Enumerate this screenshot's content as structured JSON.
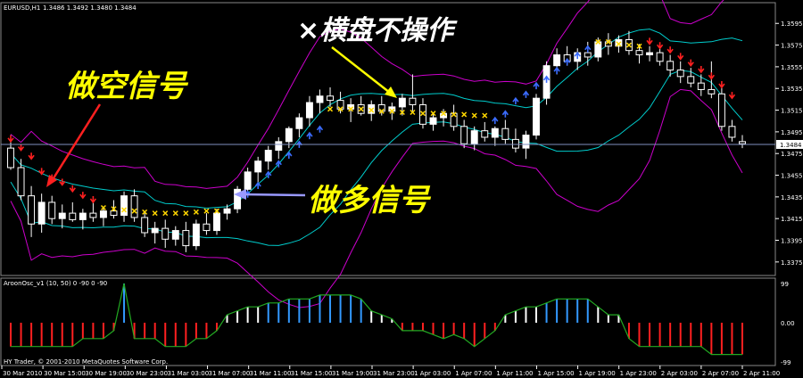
{
  "window": {
    "symbol_title": "EURUSD,H1",
    "ohlc": "1.3486 1.3492 1.3480 1.3484",
    "indicator_title": "AroonOsc_v1 (10, 50) 0 -90 0 -90",
    "copyright": "HY Trader, © 2001-2010 MetaQuotes Software Corp."
  },
  "annotations": {
    "sell_signal": "做空信号",
    "buy_signal": "做多信号",
    "range_note": "×横盘不操作"
  },
  "price_axis": {
    "current_price": "1.3484",
    "ticks": [
      "1.3595",
      "1.3575",
      "1.3555",
      "1.3535",
      "1.3515",
      "1.3495",
      "1.3475",
      "1.3455",
      "1.3435",
      "1.3415",
      "1.3395",
      "1.3375"
    ]
  },
  "osc_axis": {
    "ticks": [
      "99",
      "0.00",
      "-99"
    ]
  },
  "time_axis": {
    "labels": [
      "30 Mar 2010",
      "30 Mar 15:00",
      "30 Mar 19:00",
      "30 Mar 23:00",
      "31 Mar 03:00",
      "31 Mar 07:00",
      "31 Mar 11:00",
      "31 Mar 15:00",
      "31 Mar 19:00",
      "31 Mar 23:00",
      "1 Apr 03:00",
      "1 Apr 07:00",
      "1 Apr 11:00",
      "1 Apr 15:00",
      "1 Apr 19:00",
      "1 Apr 23:00",
      "2 Apr 03:00",
      "2 Apr 07:00",
      "2 Apr 11:00"
    ]
  },
  "colors": {
    "bg": "#000000",
    "band_outer": "#cc00cc",
    "band_inner": "#00cccc",
    "up_candle": "#ffffff",
    "down_candle": "#000000",
    "buy_arrow": "#3b6cff",
    "sell_arrow": "#ff2020",
    "range_x": "#ffd700",
    "annotation_text": "#ffff00",
    "osc_pos": "#3399ff",
    "osc_white": "#ffffff",
    "osc_neg": "#ff2020",
    "osc_line": "#22aa22",
    "grid": "#7f8fbf"
  },
  "chart_data": {
    "type": "candlestick",
    "symbol": "EURUSD",
    "timeframe": "H1",
    "price_range": [
      1.3365,
      1.361
    ],
    "candles": [
      [
        1.348,
        1.3492,
        1.346,
        1.3462
      ],
      [
        1.3462,
        1.347,
        1.3432,
        1.3436
      ],
      [
        1.3436,
        1.3445,
        1.3398,
        1.341
      ],
      [
        1.341,
        1.3438,
        1.3402,
        1.343
      ],
      [
        1.343,
        1.3436,
        1.341,
        1.3415
      ],
      [
        1.3415,
        1.3428,
        1.3406,
        1.342
      ],
      [
        1.342,
        1.343,
        1.3412,
        1.3414
      ],
      [
        1.3414,
        1.3424,
        1.3405,
        1.342
      ],
      [
        1.342,
        1.343,
        1.3412,
        1.3416
      ],
      [
        1.3416,
        1.3426,
        1.3408,
        1.3422
      ],
      [
        1.3422,
        1.3432,
        1.3415,
        1.3418
      ],
      [
        1.3418,
        1.344,
        1.3412,
        1.3436
      ],
      [
        1.3436,
        1.3442,
        1.3412,
        1.3416
      ],
      [
        1.3416,
        1.3422,
        1.3398,
        1.3402
      ],
      [
        1.3402,
        1.3412,
        1.3392,
        1.3406
      ],
      [
        1.3406,
        1.3414,
        1.3388,
        1.3396
      ],
      [
        1.3396,
        1.3408,
        1.339,
        1.3404
      ],
      [
        1.3404,
        1.3412,
        1.3384,
        1.339
      ],
      [
        1.339,
        1.3414,
        1.3386,
        1.341
      ],
      [
        1.341,
        1.342,
        1.34,
        1.3404
      ],
      [
        1.3404,
        1.3424,
        1.34,
        1.342
      ],
      [
        1.342,
        1.3428,
        1.3414,
        1.3424
      ],
      [
        1.3424,
        1.3445,
        1.342,
        1.3442
      ],
      [
        1.3442,
        1.3462,
        1.3436,
        1.3458
      ],
      [
        1.3458,
        1.3472,
        1.3448,
        1.3468
      ],
      [
        1.3468,
        1.3482,
        1.346,
        1.3478
      ],
      [
        1.3478,
        1.349,
        1.347,
        1.3486
      ],
      [
        1.3486,
        1.35,
        1.348,
        1.3498
      ],
      [
        1.3498,
        1.3512,
        1.349,
        1.3508
      ],
      [
        1.3508,
        1.3528,
        1.35,
        1.3522
      ],
      [
        1.3522,
        1.3534,
        1.3512,
        1.3528
      ],
      [
        1.3528,
        1.3536,
        1.3518,
        1.3524
      ],
      [
        1.3524,
        1.3532,
        1.3512,
        1.3516
      ],
      [
        1.3516,
        1.3526,
        1.3504,
        1.352
      ],
      [
        1.352,
        1.3528,
        1.351,
        1.3512
      ],
      [
        1.3512,
        1.3524,
        1.3505,
        1.352
      ],
      [
        1.352,
        1.3528,
        1.351,
        1.3514
      ],
      [
        1.3514,
        1.3522,
        1.3506,
        1.3518
      ],
      [
        1.3518,
        1.353,
        1.351,
        1.3526
      ],
      [
        1.3526,
        1.3548,
        1.3514,
        1.352
      ],
      [
        1.352,
        1.3526,
        1.3498,
        1.3502
      ],
      [
        1.3502,
        1.3512,
        1.3496,
        1.3508
      ],
      [
        1.3508,
        1.3516,
        1.35,
        1.3512
      ],
      [
        1.3512,
        1.352,
        1.3496,
        1.35
      ],
      [
        1.35,
        1.3506,
        1.348,
        1.3484
      ],
      [
        1.3484,
        1.35,
        1.3478,
        1.3496
      ],
      [
        1.3496,
        1.3504,
        1.3486,
        1.349
      ],
      [
        1.349,
        1.35,
        1.3482,
        1.3498
      ],
      [
        1.3498,
        1.3506,
        1.3484,
        1.3488
      ],
      [
        1.3488,
        1.3498,
        1.3476,
        1.348
      ],
      [
        1.348,
        1.3496,
        1.347,
        1.3492
      ],
      [
        1.3492,
        1.353,
        1.3488,
        1.3526
      ],
      [
        1.3526,
        1.356,
        1.352,
        1.3556
      ],
      [
        1.3556,
        1.3572,
        1.3548,
        1.3566
      ],
      [
        1.3566,
        1.3574,
        1.3556,
        1.356
      ],
      [
        1.356,
        1.3572,
        1.3552,
        1.3568
      ],
      [
        1.3568,
        1.3578,
        1.3556,
        1.3564
      ],
      [
        1.3564,
        1.3582,
        1.356,
        1.3578
      ],
      [
        1.3578,
        1.3586,
        1.3566,
        1.3574
      ],
      [
        1.3574,
        1.3584,
        1.3568,
        1.358
      ],
      [
        1.358,
        1.3588,
        1.3566,
        1.357
      ],
      [
        1.357,
        1.3576,
        1.3558,
        1.3566
      ],
      [
        1.3566,
        1.3574,
        1.356,
        1.3568
      ],
      [
        1.3568,
        1.3574,
        1.3556,
        1.356
      ],
      [
        1.356,
        1.3566,
        1.3546,
        1.3552
      ],
      [
        1.3552,
        1.356,
        1.354,
        1.3546
      ],
      [
        1.3546,
        1.3554,
        1.3536,
        1.354
      ],
      [
        1.354,
        1.3548,
        1.3528,
        1.3534
      ],
      [
        1.3534,
        1.356,
        1.3526,
        1.353
      ],
      [
        1.353,
        1.3536,
        1.3496,
        1.35
      ],
      [
        1.35,
        1.3506,
        1.3486,
        1.349
      ],
      [
        1.3486,
        1.3492,
        1.348,
        1.3484
      ]
    ],
    "signals": {
      "sell_arrows": [
        [
          0,
          1.3486
        ],
        [
          1,
          1.3478
        ],
        [
          2,
          1.347
        ],
        [
          3,
          1.3456
        ],
        [
          4,
          1.345
        ],
        [
          5,
          1.3446
        ],
        [
          6,
          1.344
        ],
        [
          7,
          1.3434
        ],
        [
          8,
          1.343
        ],
        [
          62,
          1.3576
        ],
        [
          63,
          1.3572
        ],
        [
          64,
          1.3568
        ],
        [
          65,
          1.3562
        ],
        [
          66,
          1.3556
        ],
        [
          67,
          1.355
        ],
        [
          68,
          1.3544
        ],
        [
          69,
          1.3536
        ],
        [
          70,
          1.3526
        ]
      ],
      "buy_arrows": [
        [
          23,
          1.344
        ],
        [
          24,
          1.3448
        ],
        [
          25,
          1.3458
        ],
        [
          26,
          1.3468
        ],
        [
          27,
          1.3476
        ],
        [
          28,
          1.3486
        ],
        [
          29,
          1.3494
        ],
        [
          30,
          1.35
        ],
        [
          47,
          1.3508
        ],
        [
          48,
          1.3514
        ],
        [
          49,
          1.3526
        ],
        [
          50,
          1.3532
        ],
        [
          51,
          1.354
        ],
        [
          52,
          1.3546
        ],
        [
          53,
          1.3554
        ],
        [
          54,
          1.3562
        ],
        [
          55,
          1.3568
        ],
        [
          56,
          1.3574
        ]
      ],
      "range_x": [
        [
          9,
          1.3425
        ],
        [
          10,
          1.3424
        ],
        [
          11,
          1.3423
        ],
        [
          12,
          1.3422
        ],
        [
          13,
          1.3421
        ],
        [
          14,
          1.342
        ],
        [
          15,
          1.342
        ],
        [
          16,
          1.342
        ],
        [
          17,
          1.342
        ],
        [
          18,
          1.3421
        ],
        [
          19,
          1.3422
        ],
        [
          20,
          1.3422
        ],
        [
          31,
          1.3516
        ],
        [
          32,
          1.3516
        ],
        [
          33,
          1.3516
        ],
        [
          34,
          1.3516
        ],
        [
          35,
          1.3515
        ],
        [
          36,
          1.3514
        ],
        [
          37,
          1.3514
        ],
        [
          38,
          1.3513
        ],
        [
          39,
          1.3513
        ],
        [
          40,
          1.3512
        ],
        [
          41,
          1.3512
        ],
        [
          42,
          1.3512
        ],
        [
          43,
          1.3511
        ],
        [
          44,
          1.3511
        ],
        [
          45,
          1.351
        ],
        [
          46,
          1.351
        ],
        [
          57,
          1.3578
        ],
        [
          58,
          1.3578
        ],
        [
          59,
          1.3576
        ],
        [
          60,
          1.3575
        ],
        [
          61,
          1.3574
        ]
      ]
    },
    "oscillator": {
      "range": [
        -99,
        99
      ],
      "values": [
        -60,
        -60,
        -60,
        -60,
        -60,
        -60,
        -60,
        -40,
        -40,
        -40,
        -20,
        99,
        -40,
        -40,
        -40,
        -60,
        -60,
        -60,
        -40,
        -40,
        -20,
        20,
        30,
        40,
        40,
        50,
        50,
        60,
        60,
        60,
        70,
        70,
        70,
        70,
        60,
        30,
        20,
        10,
        -20,
        -20,
        -20,
        -30,
        -40,
        -30,
        -40,
        -60,
        -40,
        -20,
        20,
        30,
        40,
        40,
        50,
        60,
        60,
        60,
        60,
        40,
        20,
        20,
        -40,
        -60,
        -60,
        -60,
        -60,
        -60,
        -60,
        -60,
        -80,
        -80,
        -80,
        -80
      ]
    }
  }
}
